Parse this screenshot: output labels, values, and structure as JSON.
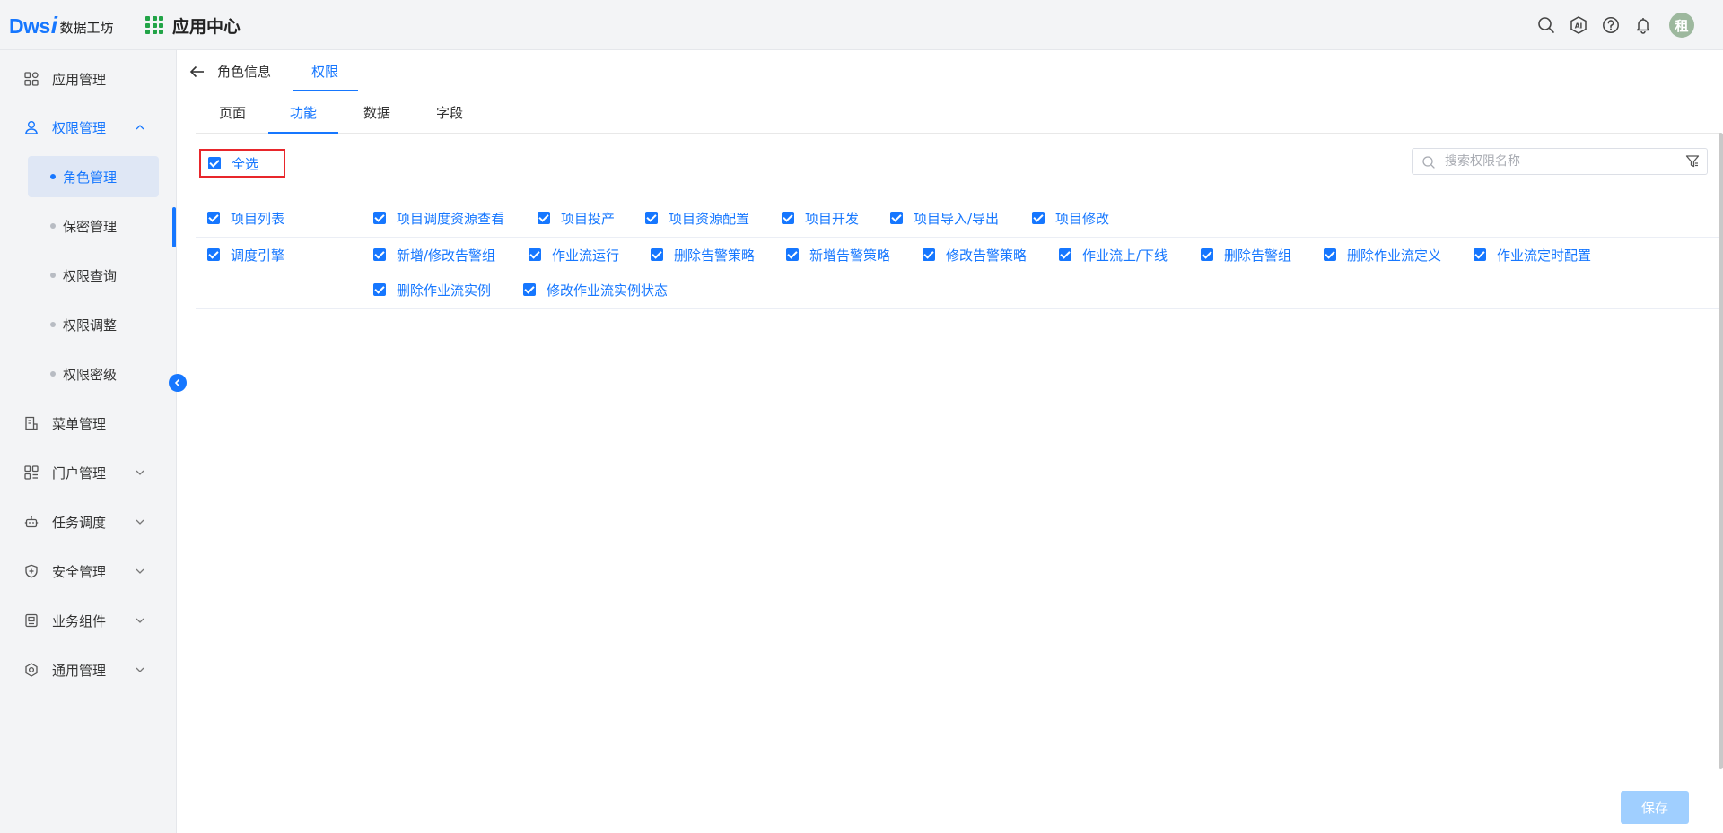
{
  "app": {
    "logo_mark": "Dws",
    "logo_mark_i": "i",
    "logo_text": "数据工坊",
    "center_label": "应用中心",
    "avatar_text": "租"
  },
  "topbar_icons": [
    "search-icon",
    "ai-icon",
    "help-icon",
    "bell-icon"
  ],
  "sidebar": {
    "items": [
      {
        "label": "应用管理",
        "icon": "apps-icon"
      },
      {
        "label": "权限管理",
        "icon": "user-icon"
      },
      {
        "label": "菜单管理",
        "icon": "menu-doc-icon"
      },
      {
        "label": "门户管理",
        "icon": "portal-icon"
      },
      {
        "label": "任务调度",
        "icon": "robot-icon"
      },
      {
        "label": "安全管理",
        "icon": "shield-icon"
      },
      {
        "label": "业务组件",
        "icon": "component-icon"
      },
      {
        "label": "通用管理",
        "icon": "settings-icon"
      }
    ],
    "sub_items": [
      {
        "label": "角色管理",
        "active": true
      },
      {
        "label": "保密管理"
      },
      {
        "label": "权限查询"
      },
      {
        "label": "权限调整"
      },
      {
        "label": "权限密级"
      }
    ]
  },
  "header_tabs": [
    {
      "label": "角色信息"
    },
    {
      "label": "权限",
      "active": true
    }
  ],
  "sub_tabs": [
    {
      "label": "页面"
    },
    {
      "label": "功能",
      "active": true
    },
    {
      "label": "数据"
    },
    {
      "label": "字段"
    }
  ],
  "select_all": {
    "label": "全选",
    "checked": true
  },
  "search": {
    "placeholder": "搜索权限名称",
    "value": ""
  },
  "permissions": {
    "group1": {
      "name": "项目列表",
      "items": [
        "项目调度资源查看",
        "项目投产",
        "项目资源配置",
        "项目开发",
        "项目导入/导出",
        "项目修改"
      ]
    },
    "group2": {
      "name": "调度引擎",
      "items": [
        "新增/修改告警组",
        "作业流运行",
        "删除告警策略",
        "新增告警策略",
        "修改告警策略",
        "作业流上/下线",
        "删除告警组",
        "删除作业流定义",
        "作业流定时配置",
        "删除作业流实例",
        "修改作业流实例状态"
      ]
    }
  },
  "save_label": "保存",
  "colors": {
    "accent": "#1677ff",
    "highlight_border": "#e8262b",
    "save_disabled": "#a0cfff"
  }
}
